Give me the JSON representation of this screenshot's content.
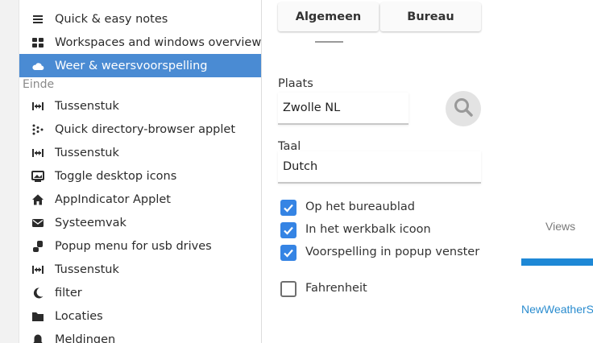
{
  "background_page": {
    "views_label": "Views",
    "link_text": "NewWeatherSn",
    "accent_color": "#1e88d6"
  },
  "sidebar": {
    "selected_color": "#4a8bd3",
    "section_label": "Einde",
    "items_top": [
      {
        "label": "Quick & easy notes",
        "icon": "list-icon"
      },
      {
        "label": "Workspaces and windows overview",
        "icon": "workspaces-icon"
      },
      {
        "label": "Weer & weersvoorspelling",
        "icon": "cloud-icon",
        "selected": true
      }
    ],
    "items_bottom": [
      {
        "label": "Tussenstuk",
        "icon": "spacer-icon"
      },
      {
        "label": "Quick directory-browser applet",
        "icon": "dots-icon"
      },
      {
        "label": "Tussenstuk",
        "icon": "spacer-icon"
      },
      {
        "label": "Toggle desktop icons",
        "icon": "desktop-icon"
      },
      {
        "label": "AppIndicator Applet",
        "icon": "home-icon"
      },
      {
        "label": "Systeemvak",
        "icon": "envelope-icon"
      },
      {
        "label": "Popup menu for usb drives",
        "icon": "usb-icon"
      },
      {
        "label": "Tussenstuk",
        "icon": "spacer-icon"
      },
      {
        "label": "filter",
        "icon": "moon-icon"
      },
      {
        "label": "Locaties",
        "icon": "folder-icon"
      },
      {
        "label": "Meldingen",
        "icon": "bell-icon"
      }
    ]
  },
  "settings": {
    "tabs": [
      "Algemeen",
      "Bureau"
    ],
    "place_label": "Plaats",
    "place_value": "Zwolle NL",
    "language_label": "Taal",
    "language_value": "Dutch",
    "checkboxes": [
      {
        "label": "Op het bureaublad",
        "checked": true
      },
      {
        "label": "In het werkbalk icoon",
        "checked": true
      },
      {
        "label": "Voorspelling in popup venster",
        "checked": true
      },
      {
        "label": "Fahrenheit",
        "checked": false
      }
    ],
    "check_color": "#3584e4"
  }
}
